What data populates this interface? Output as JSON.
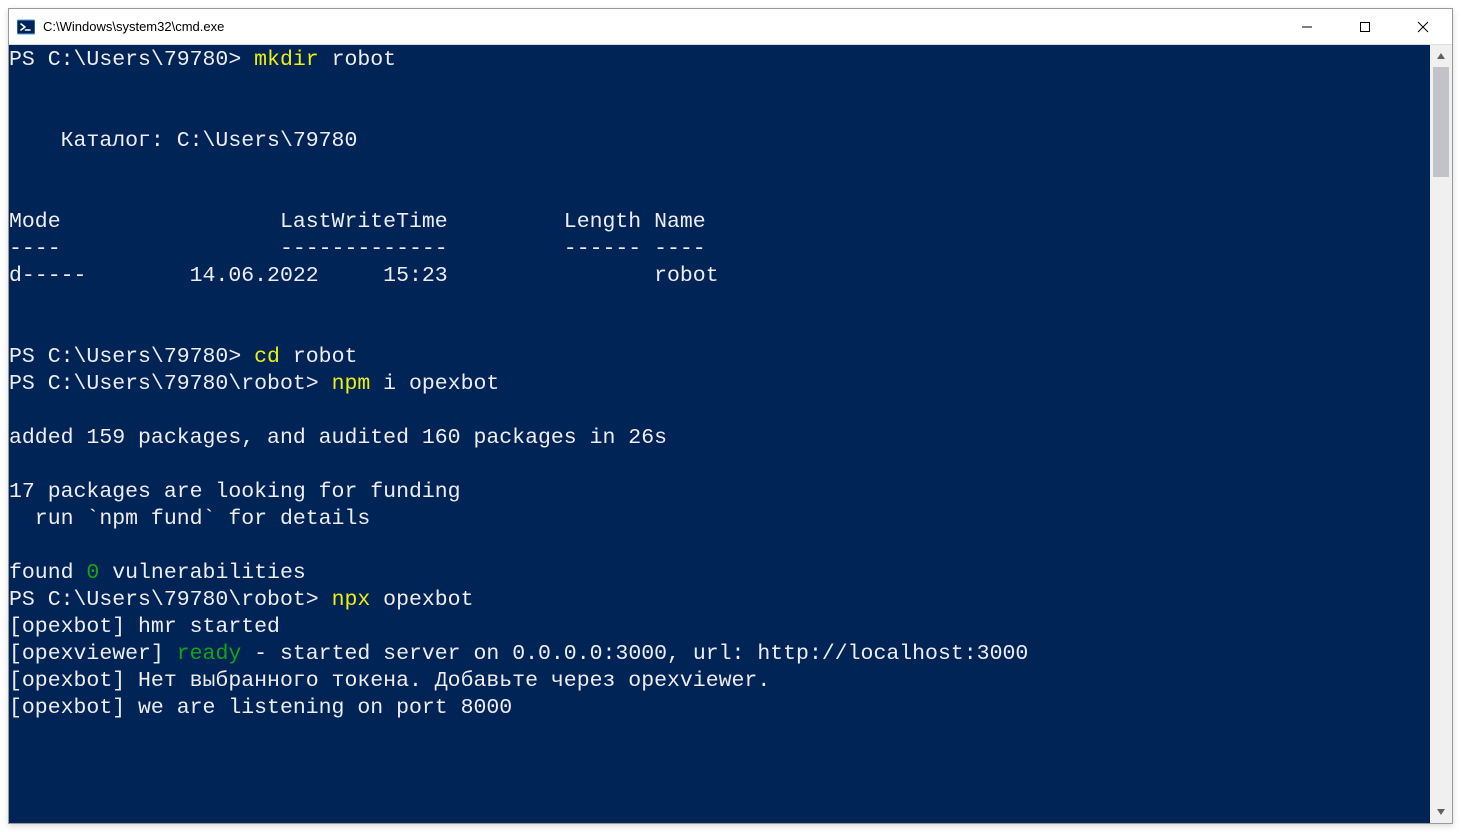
{
  "window": {
    "title": "C:\\Windows\\system32\\cmd.exe"
  },
  "lines": [
    [
      {
        "cls": "c-prompt",
        "text": "PS C:\\Users\\79780> "
      },
      {
        "cls": "c-yellow",
        "text": "mkdir "
      },
      {
        "cls": "c-white",
        "text": "robot"
      }
    ],
    [
      {
        "cls": "c-white",
        "text": ""
      }
    ],
    [
      {
        "cls": "c-white",
        "text": ""
      }
    ],
    [
      {
        "cls": "c-white",
        "text": "    Каталог: C:\\Users\\79780"
      }
    ],
    [
      {
        "cls": "c-white",
        "text": ""
      }
    ],
    [
      {
        "cls": "c-white",
        "text": ""
      }
    ],
    [
      {
        "cls": "c-white",
        "text": "Mode                 LastWriteTime         Length Name"
      }
    ],
    [
      {
        "cls": "c-white",
        "text": "----                 -------------         ------ ----"
      }
    ],
    [
      {
        "cls": "c-white",
        "text": "d-----        14.06.2022     15:23                robot"
      }
    ],
    [
      {
        "cls": "c-white",
        "text": ""
      }
    ],
    [
      {
        "cls": "c-white",
        "text": ""
      }
    ],
    [
      {
        "cls": "c-prompt",
        "text": "PS C:\\Users\\79780> "
      },
      {
        "cls": "c-yellow",
        "text": "cd "
      },
      {
        "cls": "c-white",
        "text": "robot"
      }
    ],
    [
      {
        "cls": "c-prompt",
        "text": "PS C:\\Users\\79780\\robot> "
      },
      {
        "cls": "c-yellow",
        "text": "npm "
      },
      {
        "cls": "c-white",
        "text": "i opexbot"
      }
    ],
    [
      {
        "cls": "c-white",
        "text": ""
      }
    ],
    [
      {
        "cls": "c-white",
        "text": "added 159 packages, and audited 160 packages in 26s"
      }
    ],
    [
      {
        "cls": "c-white",
        "text": ""
      }
    ],
    [
      {
        "cls": "c-white",
        "text": "17 packages are looking for funding"
      }
    ],
    [
      {
        "cls": "c-white",
        "text": "  run `npm fund` for details"
      }
    ],
    [
      {
        "cls": "c-white",
        "text": ""
      }
    ],
    [
      {
        "cls": "c-white",
        "text": "found "
      },
      {
        "cls": "c-green",
        "text": "0"
      },
      {
        "cls": "c-white",
        "text": " vulnerabilities"
      }
    ],
    [
      {
        "cls": "c-prompt",
        "text": "PS C:\\Users\\79780\\robot> "
      },
      {
        "cls": "c-yellow",
        "text": "npx "
      },
      {
        "cls": "c-white",
        "text": "opexbot"
      }
    ],
    [
      {
        "cls": "c-white",
        "text": "[opexbot] hmr started"
      }
    ],
    [
      {
        "cls": "c-white",
        "text": "[opexviewer] "
      },
      {
        "cls": "c-green",
        "text": "ready"
      },
      {
        "cls": "c-white",
        "text": " - started server on 0.0.0.0:3000, url: http://localhost:3000"
      }
    ],
    [
      {
        "cls": "c-white",
        "text": "[opexbot] Нет выбранного токена. Добавьте через opexviewer."
      }
    ],
    [
      {
        "cls": "c-white",
        "text": "[opexbot] we are listening on port 8000"
      }
    ]
  ]
}
